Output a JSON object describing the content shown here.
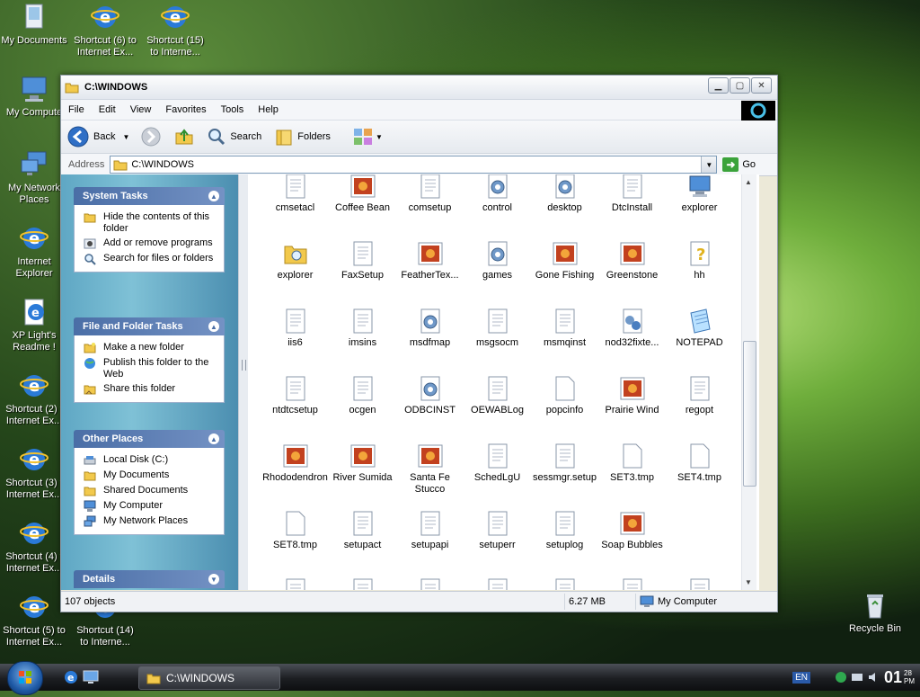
{
  "desktop": {
    "icons": [
      {
        "label": "My Documents",
        "icon": "my-documents-icon"
      },
      {
        "label": "Shortcut (6) to Internet Ex...",
        "icon": "internet-explorer-icon"
      },
      {
        "label": "Shortcut (15) to Interne...",
        "icon": "internet-explorer-icon"
      },
      {
        "label": "My Compute",
        "icon": "my-computer-icon"
      },
      {
        "label": "My Network Places",
        "icon": "network-icon"
      },
      {
        "label": "Internet Explorer",
        "icon": "internet-explorer-icon"
      },
      {
        "label": "XP Light's Readme !",
        "icon": "readme-icon"
      },
      {
        "label": "Shortcut (2) t Internet Ex...",
        "icon": "internet-explorer-icon"
      },
      {
        "label": "Shortcut (3) t Internet Ex...",
        "icon": "internet-explorer-icon"
      },
      {
        "label": "Shortcut (4) t Internet Ex...",
        "icon": "internet-explorer-icon"
      },
      {
        "label": "Shortcut (5) to Internet Ex...",
        "icon": "internet-explorer-icon"
      },
      {
        "label": "Shortcut (14) to Interne...",
        "icon": "internet-explorer-icon"
      },
      {
        "label": "Recycle Bin",
        "icon": "recycle-bin-icon"
      }
    ]
  },
  "window": {
    "title": "C:\\WINDOWS",
    "menu": [
      "File",
      "Edit",
      "View",
      "Favorites",
      "Tools",
      "Help"
    ],
    "toolbar": {
      "back": "Back",
      "search": "Search",
      "folders": "Folders"
    },
    "address": {
      "label": "Address",
      "value": "C:\\WINDOWS",
      "go": "Go"
    },
    "tasks": {
      "system": {
        "title": "System Tasks",
        "items": [
          "Hide the contents of this folder",
          "Add or remove programs",
          "Search for files or folders"
        ]
      },
      "file_folder": {
        "title": "File and Folder Tasks",
        "items": [
          "Make a new folder",
          "Publish this folder to the Web",
          "Share this folder"
        ]
      },
      "other": {
        "title": "Other Places",
        "items": [
          "Local Disk (C:)",
          "My Documents",
          "Shared Documents",
          "My Computer",
          "My Network Places"
        ]
      },
      "details": {
        "title": "Details"
      }
    },
    "files": [
      {
        "name": "cmsetacl",
        "icon": "text-file-icon"
      },
      {
        "name": "Coffee Bean",
        "icon": "image-file-icon"
      },
      {
        "name": "comsetup",
        "icon": "text-file-icon"
      },
      {
        "name": "control",
        "icon": "settings-file-icon"
      },
      {
        "name": "desktop",
        "icon": "settings-file-icon"
      },
      {
        "name": "DtcInstall",
        "icon": "text-file-icon"
      },
      {
        "name": "explorer",
        "icon": "computer-program-icon"
      },
      {
        "name": "explorer",
        "icon": "folder-search-icon"
      },
      {
        "name": "FaxSetup",
        "icon": "text-file-icon"
      },
      {
        "name": "FeatherTex...",
        "icon": "image-file-icon"
      },
      {
        "name": "games",
        "icon": "settings-file-icon"
      },
      {
        "name": "Gone Fishing",
        "icon": "image-file-icon"
      },
      {
        "name": "Greenstone",
        "icon": "image-file-icon"
      },
      {
        "name": "hh",
        "icon": "help-icon"
      },
      {
        "name": "iis6",
        "icon": "text-file-icon"
      },
      {
        "name": "imsins",
        "icon": "text-file-icon"
      },
      {
        "name": "msdfmap",
        "icon": "settings-file-icon"
      },
      {
        "name": "msgsocm",
        "icon": "text-file-icon"
      },
      {
        "name": "msmqinst",
        "icon": "text-file-icon"
      },
      {
        "name": "nod32fixte...",
        "icon": "program-file-icon"
      },
      {
        "name": "NOTEPAD",
        "icon": "notepad-icon"
      },
      {
        "name": "ntdtcsetup",
        "icon": "text-file-icon"
      },
      {
        "name": "ocgen",
        "icon": "text-file-icon"
      },
      {
        "name": "ODBCINST",
        "icon": "settings-file-icon"
      },
      {
        "name": "OEWABLog",
        "icon": "text-file-icon"
      },
      {
        "name": "popcinfo",
        "icon": "blank-file-icon"
      },
      {
        "name": "Prairie Wind",
        "icon": "image-file-icon"
      },
      {
        "name": "regopt",
        "icon": "text-file-icon"
      },
      {
        "name": "Rhododendron",
        "icon": "image-file-icon"
      },
      {
        "name": "River Sumida",
        "icon": "image-file-icon"
      },
      {
        "name": "Santa Fe Stucco",
        "icon": "image-file-icon"
      },
      {
        "name": "SchedLgU",
        "icon": "text-file-icon"
      },
      {
        "name": "sessmgr.setup",
        "icon": "text-file-icon"
      },
      {
        "name": "SET3.tmp",
        "icon": "blank-file-icon"
      },
      {
        "name": "SET4.tmp",
        "icon": "blank-file-icon"
      },
      {
        "name": "SET8.tmp",
        "icon": "blank-file-icon"
      },
      {
        "name": "setupact",
        "icon": "text-file-icon"
      },
      {
        "name": "setupapi",
        "icon": "text-file-icon"
      },
      {
        "name": "setuperr",
        "icon": "text-file-icon"
      },
      {
        "name": "setuplog",
        "icon": "text-file-icon"
      },
      {
        "name": "Soap Bubbles",
        "icon": "image-file-icon"
      }
    ],
    "status": {
      "count": "107 objects",
      "size": "6.27 MB",
      "location": "My Computer"
    }
  },
  "taskbar": {
    "task": "C:\\WINDOWS",
    "lang": "EN",
    "clock_time": "01",
    "clock_min": "28",
    "clock_ampm": "PM"
  }
}
